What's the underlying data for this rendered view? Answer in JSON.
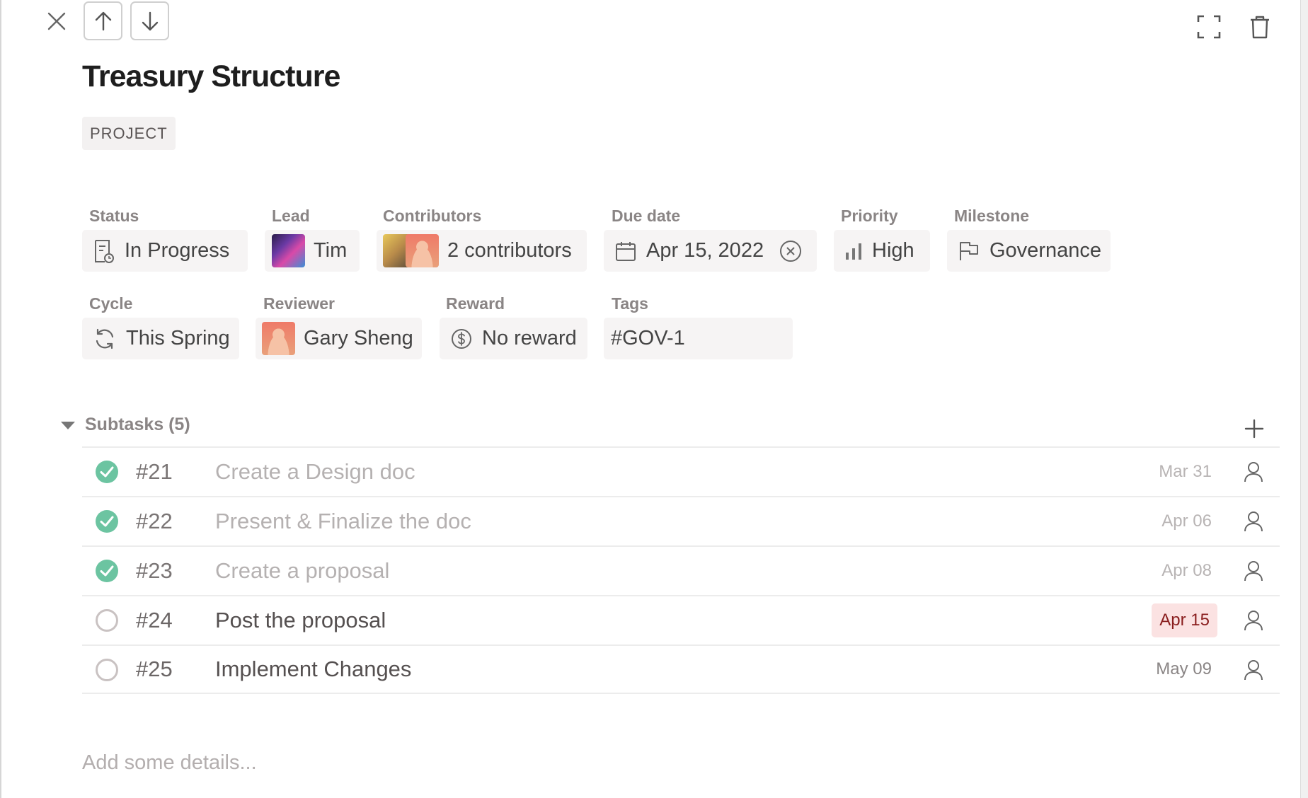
{
  "task": {
    "title": "Treasury Structure",
    "type_label": "PROJECT"
  },
  "properties": {
    "status": {
      "label": "Status",
      "value": "In Progress"
    },
    "lead": {
      "label": "Lead",
      "value": "Tim"
    },
    "contributors": {
      "label": "Contributors",
      "value": "2 contributors"
    },
    "due_date": {
      "label": "Due date",
      "value": "Apr 15, 2022"
    },
    "priority": {
      "label": "Priority",
      "value": "High"
    },
    "milestone": {
      "label": "Milestone",
      "value": "Governance"
    },
    "cycle": {
      "label": "Cycle",
      "value": "This Spring"
    },
    "reviewer": {
      "label": "Reviewer",
      "value": "Gary Sheng"
    },
    "reward": {
      "label": "Reward",
      "value": "No reward"
    },
    "tags": {
      "label": "Tags",
      "value": "#GOV-1"
    }
  },
  "subtasks": {
    "header": "Subtasks (5)",
    "items": [
      {
        "number": "#21",
        "title": "Create a Design doc",
        "due": "Mar 31",
        "done": true
      },
      {
        "number": "#22",
        "title": "Present & Finalize the doc",
        "due": "Apr 06",
        "done": true
      },
      {
        "number": "#23",
        "title": "Create a proposal",
        "due": "Apr 08",
        "done": true
      },
      {
        "number": "#24",
        "title": "Post the proposal",
        "due": "Apr 15",
        "done": false,
        "overdue": true
      },
      {
        "number": "#25",
        "title": "Implement Changes",
        "due": "May 09",
        "done": false
      }
    ]
  },
  "details": {
    "placeholder": "Add some details..."
  },
  "colors": {
    "check_done": "#6cc4a1",
    "overdue_bg": "#fbe2e2",
    "overdue_text": "#8a1e1e",
    "label_gray": "#8a8585"
  },
  "icons": {
    "close": "close-icon",
    "nav_up": "arrow-up-icon",
    "nav_down": "arrow-down-icon",
    "expand": "expand-icon",
    "trash": "trash-icon",
    "status": "document-status-icon",
    "due": "calendar-icon",
    "clear": "clear-circle-icon",
    "priority": "bar-chart-icon",
    "milestone": "flag-icon",
    "cycle": "cycle-icon",
    "reward": "dollar-circle-icon",
    "add": "plus-icon",
    "assignee": "person-icon"
  }
}
